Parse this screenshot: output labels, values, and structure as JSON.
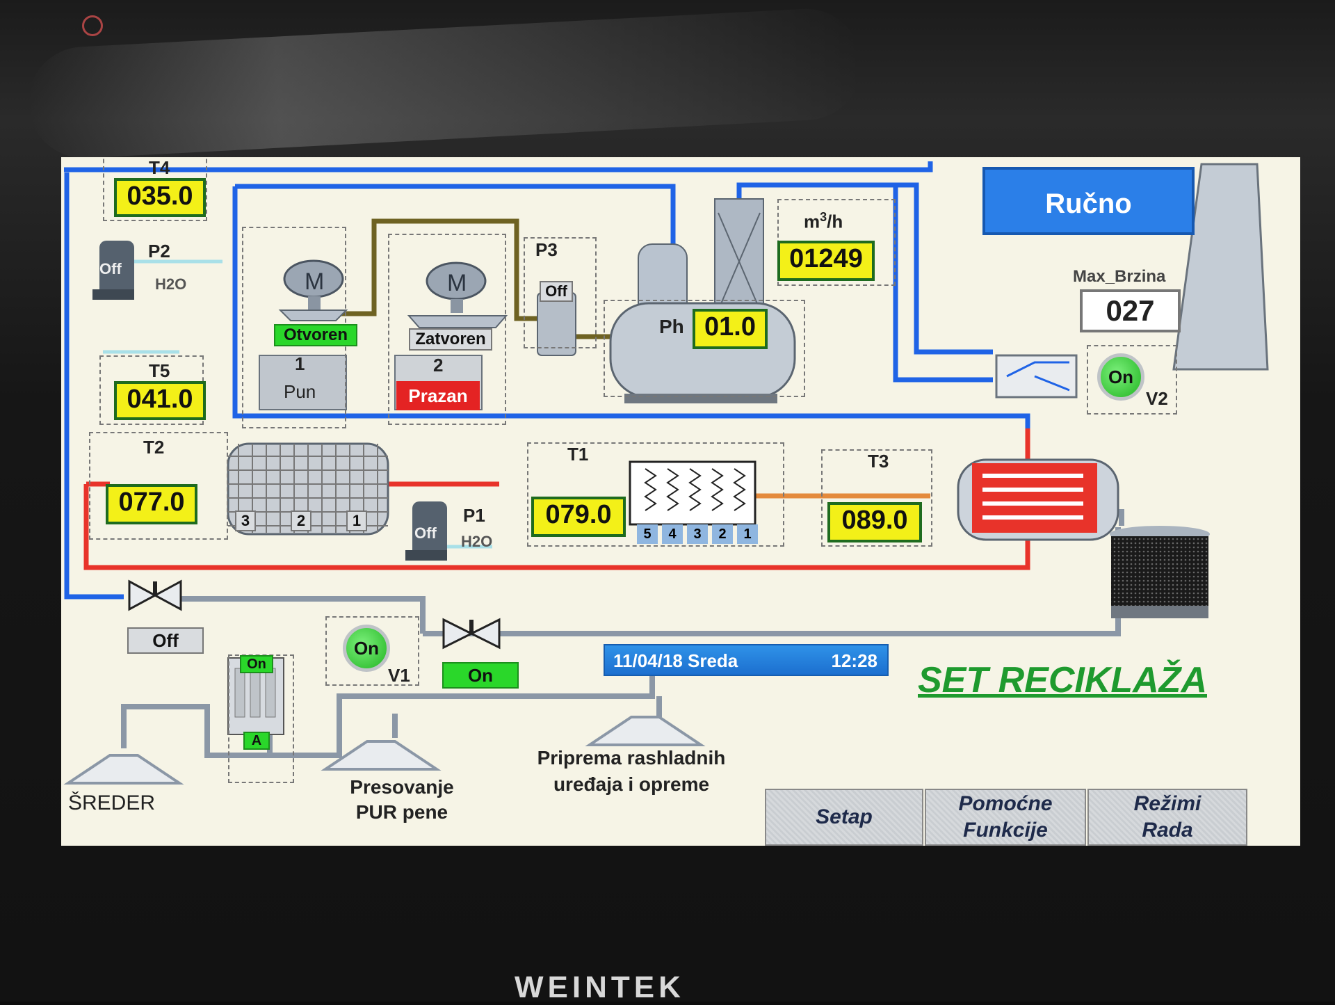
{
  "mode_button": "Ručno",
  "temps": {
    "t4": {
      "label": "T4",
      "value": "035.0"
    },
    "t5": {
      "label": "T5",
      "value": "041.0"
    },
    "t2": {
      "label": "T2",
      "value": "077.0"
    },
    "t1": {
      "label": "T1",
      "value": "079.0"
    },
    "t3": {
      "label": "T3",
      "value": "089.0"
    }
  },
  "flow": {
    "unit": "m3/h",
    "value": "01249"
  },
  "ph": {
    "label": "Ph",
    "value": "01.0"
  },
  "max_speed": {
    "label": "Max_Brzina",
    "value": "027"
  },
  "pumps": {
    "p1": {
      "label": "P1",
      "state": "Off",
      "medium": "H2O"
    },
    "p2": {
      "label": "P2",
      "state": "Off",
      "medium": "H2O"
    },
    "p3": {
      "label": "P3",
      "state": "Off"
    }
  },
  "mixer1": {
    "state": "Otvoren",
    "number": "1",
    "level": "Pun"
  },
  "mixer2": {
    "state": "Zatvoren",
    "number": "2",
    "level": "Prazan"
  },
  "v1": {
    "label": "V1",
    "state": "On"
  },
  "v2": {
    "label": "V2",
    "state": "On"
  },
  "valve_left": {
    "state": "Off"
  },
  "valve_mid": {
    "state": "On"
  },
  "filter": {
    "top": "On",
    "bottom": "A"
  },
  "heater_t2_stages": [
    "3",
    "2",
    "1"
  ],
  "heater_t1_stages": [
    "5",
    "4",
    "3",
    "2",
    "1"
  ],
  "datetime": {
    "date": "11/04/18 Sreda",
    "time": "12:28"
  },
  "screen_title": "SET RECIKLAŽA",
  "stations": {
    "sreder": "ŠREDER",
    "presovanje_line1": "Presovanje",
    "presovanje_line2": "PUR pene",
    "priprema_line1": "Priprema rashladnih",
    "priprema_line2": "uređaja i opreme"
  },
  "nav": {
    "setap": "Setap",
    "pomocne_line1": "Pomoćne",
    "pomocne_line2": "Funkcije",
    "rezimi_line1": "Režimi",
    "rezimi_line2": "Rada"
  },
  "bezel_brand": "WEINTEK",
  "colors": {
    "pipe_blue": "#1f63e6",
    "pipe_red": "#e8332a",
    "pipe_olive": "#6e6222",
    "pipe_gray": "#8b97a6",
    "display_yellow": "#f3f018",
    "status_green": "#2ad72a",
    "status_red": "#e42323"
  }
}
